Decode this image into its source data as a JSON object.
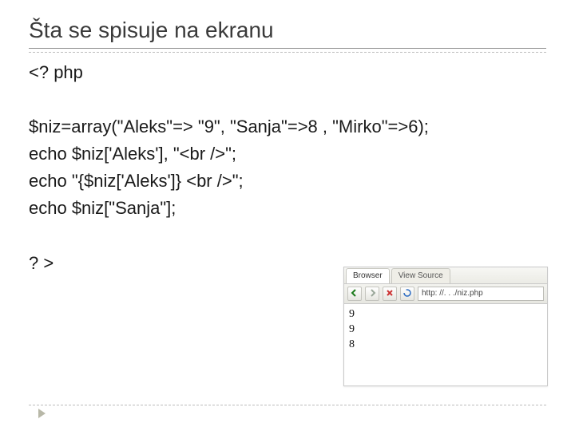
{
  "title": "Šta se spisuje na ekranu",
  "code": {
    "l1": "<? php",
    "l2": "$niz=array(\"Aleks\"=> \"9\", \"Sanja\"=>8 , \"Mirko\"=>6);",
    "l3": "echo $niz['Aleks'], \"<br />\";",
    "l4": "echo \"{$niz['Aleks']} <br />\";",
    "l5": "echo $niz[\"Sanja\"];",
    "l6": "? >"
  },
  "preview": {
    "tabs": {
      "browser": "Browser",
      "source": "View Source"
    },
    "toolbar": {
      "back": "back-icon",
      "forward": "forward-icon",
      "stop": "stop-icon",
      "refresh": "refresh-icon",
      "address": "http: //. . ./niz.php"
    },
    "output": {
      "l1": "9",
      "l2": "9",
      "l3": "8"
    }
  }
}
